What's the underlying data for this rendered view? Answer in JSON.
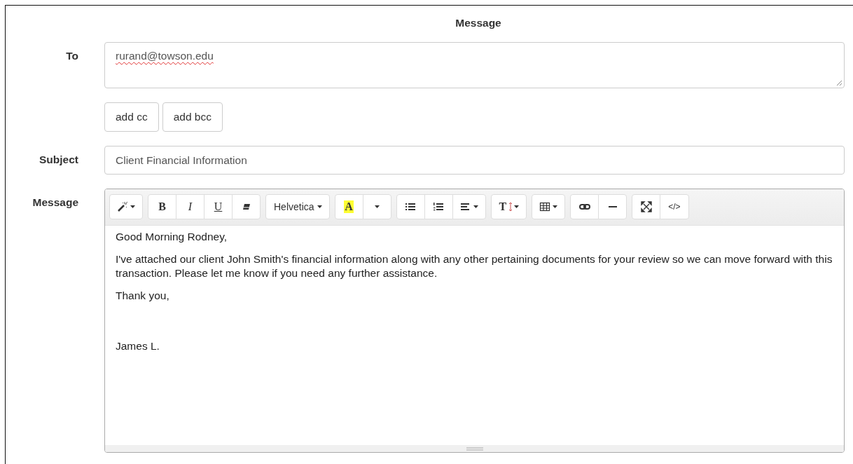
{
  "heading": "Message",
  "to": {
    "label": "To",
    "value": "rurand@towson.edu",
    "spellcheck_flag": true
  },
  "cc_buttons": [
    "add cc",
    "add bcc"
  ],
  "subject": {
    "label": "Subject",
    "value": "Client Financial Information"
  },
  "message": {
    "label": "Message",
    "toolbar": [
      {
        "buttons": [
          {
            "kind": "magic"
          }
        ]
      },
      {
        "buttons": [
          {
            "kind": "bold",
            "label": "B"
          },
          {
            "kind": "italic",
            "label": "I"
          },
          {
            "kind": "underline",
            "label": "U"
          },
          {
            "kind": "eraser"
          }
        ]
      },
      {
        "buttons": [
          {
            "kind": "font",
            "label": "Helvetica"
          }
        ]
      },
      {
        "buttons": [
          {
            "kind": "highlight",
            "label": "A"
          },
          {
            "kind": "dropdown"
          }
        ]
      },
      {
        "buttons": [
          {
            "kind": "bullets"
          },
          {
            "kind": "numbers"
          },
          {
            "kind": "align"
          }
        ]
      },
      {
        "buttons": [
          {
            "kind": "size",
            "label": "T"
          }
        ]
      },
      {
        "buttons": [
          {
            "kind": "table"
          }
        ]
      },
      {
        "buttons": [
          {
            "kind": "link"
          },
          {
            "kind": "rule"
          }
        ]
      },
      {
        "buttons": [
          {
            "kind": "fullscreen"
          },
          {
            "kind": "code",
            "label": "</>"
          }
        ]
      }
    ],
    "paragraphs": [
      "Good Morning Rodney,",
      "I've attached our client John Smith's financial information along with any other pertaining documents for your review so we can move forward with this transaction. Please let me know if you need any further assistance.",
      "Thank you,",
      "James L."
    ]
  }
}
